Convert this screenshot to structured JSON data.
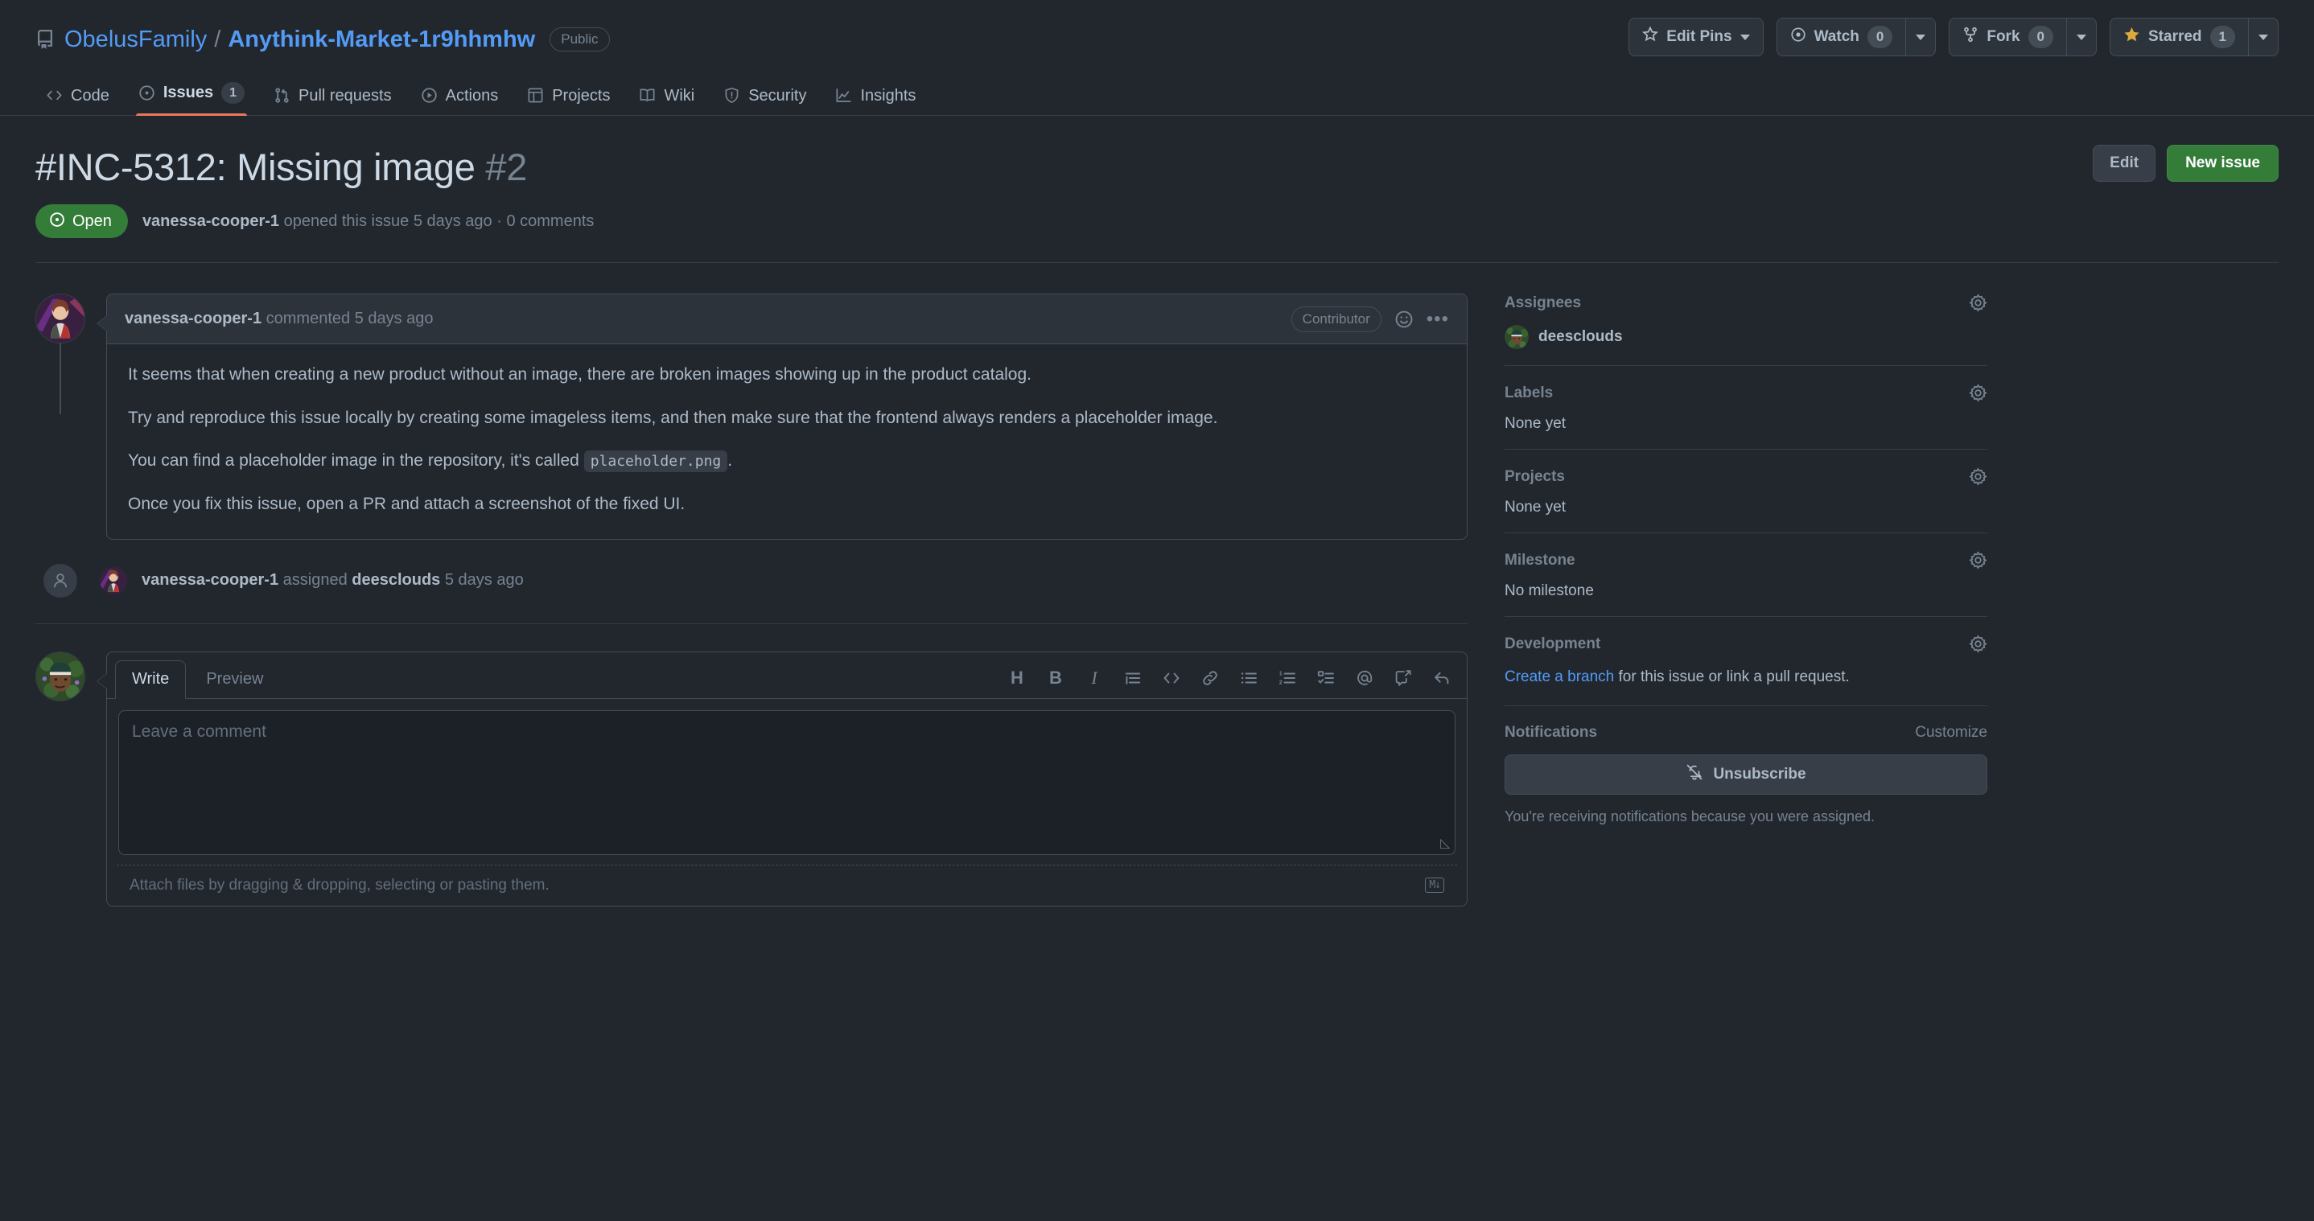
{
  "repo": {
    "owner": "ObelusFamily",
    "separator": "/",
    "name": "Anythink-Market-1r9hhmhw",
    "visibility": "Public",
    "repo_icon": "book-icon"
  },
  "repo_actions": {
    "edit_pins": {
      "label": "Edit Pins",
      "icon": "pin-icon"
    },
    "watch": {
      "label": "Watch",
      "count": "0",
      "icon": "eye-icon"
    },
    "fork": {
      "label": "Fork",
      "count": "0",
      "icon": "repo-forked-icon"
    },
    "starred": {
      "label": "Starred",
      "count": "1",
      "icon": "star-icon"
    }
  },
  "nav_tabs": [
    {
      "label": "Code",
      "icon": "code-icon",
      "count": null,
      "selected": false
    },
    {
      "label": "Issues",
      "icon": "issue-opened-icon",
      "count": "1",
      "selected": true
    },
    {
      "label": "Pull requests",
      "icon": "git-pull-request-icon",
      "count": null,
      "selected": false
    },
    {
      "label": "Actions",
      "icon": "play-icon",
      "count": null,
      "selected": false
    },
    {
      "label": "Projects",
      "icon": "table-icon",
      "count": null,
      "selected": false
    },
    {
      "label": "Wiki",
      "icon": "book-icon",
      "count": null,
      "selected": false
    },
    {
      "label": "Security",
      "icon": "shield-icon",
      "count": null,
      "selected": false
    },
    {
      "label": "Insights",
      "icon": "graph-icon",
      "count": null,
      "selected": false
    }
  ],
  "issue": {
    "title": "#INC-5312: Missing image",
    "number": "#2",
    "state": "Open",
    "state_color": "#347d39",
    "author": "vanessa-cooper-1",
    "opened_text": "opened this issue",
    "opened_time": "5 days ago",
    "comments_count": "0 comments",
    "separator_dot": "·",
    "edit_label": "Edit",
    "new_issue_label": "New issue"
  },
  "comment": {
    "author": "vanessa-cooper-1",
    "action": "commented",
    "time": "5 days ago",
    "role": "Contributor",
    "emoji_icon": "smiley-icon",
    "menu_icon": "kebab-horizontal-icon",
    "paragraphs": [
      "It seems that when creating a new product without an image, there are broken images showing up in the product catalog.",
      "Try and reproduce this issue locally by creating some imageless items, and then make sure that the frontend always renders a placeholder image."
    ],
    "p3_before": "You can find a placeholder image in the repository, it's called",
    "p3_code": "placeholder.png",
    "p3_after": ".",
    "p4": "Once you fix this issue, open a PR and attach a screenshot of the fixed UI."
  },
  "timeline_event": {
    "icon": "person-icon",
    "actor": "vanessa-cooper-1",
    "action": "assigned",
    "target": "deesclouds",
    "time": "5 days ago"
  },
  "composer": {
    "tabs": [
      {
        "label": "Write",
        "active": true
      },
      {
        "label": "Preview",
        "active": false
      }
    ],
    "toolbar": [
      {
        "name": "heading-icon",
        "glyph": "H"
      },
      {
        "name": "bold-icon",
        "glyph": "B"
      },
      {
        "name": "italic-icon",
        "glyph": "I"
      },
      {
        "name": "quote-icon",
        "glyph": ""
      },
      {
        "name": "code-icon",
        "glyph": ""
      },
      {
        "name": "link-icon",
        "glyph": ""
      },
      {
        "name": "unordered-list-icon",
        "glyph": ""
      },
      {
        "name": "ordered-list-icon",
        "glyph": ""
      },
      {
        "name": "task-list-icon",
        "glyph": ""
      },
      {
        "name": "mention-icon",
        "glyph": "@"
      },
      {
        "name": "reference-icon",
        "glyph": ""
      },
      {
        "name": "reply-icon",
        "glyph": ""
      }
    ],
    "placeholder": "Leave a comment",
    "value": "",
    "attach_text": "Attach files by dragging & dropping, selecting or pasting them.",
    "markdown_badge": "M↓"
  },
  "sidebar": {
    "assignees": {
      "title": "Assignees",
      "gear_icon": "gear-icon",
      "items": [
        {
          "name": "deesclouds"
        }
      ]
    },
    "labels": {
      "title": "Labels",
      "gear_icon": "gear-icon",
      "empty": "None yet"
    },
    "projects": {
      "title": "Projects",
      "gear_icon": "gear-icon",
      "empty": "None yet"
    },
    "milestone": {
      "title": "Milestone",
      "gear_icon": "gear-icon",
      "empty": "No milestone"
    },
    "development": {
      "title": "Development",
      "gear_icon": "gear-icon",
      "link": "Create a branch",
      "rest": " for this issue or link a pull request."
    },
    "notifications": {
      "title": "Notifications",
      "customize": "Customize",
      "button_label": "Unsubscribe",
      "bell_icon": "bell-slash-icon",
      "note": "You're receiving notifications because you were assigned."
    }
  },
  "colors": {
    "page_bg": "#22272e",
    "surface": "#2d333b",
    "border": "#444c56",
    "accent_blue": "#539bf5",
    "accent_green": "#347d39",
    "accent_orange": "#ec775c",
    "text": "#adbac7",
    "muted": "#768390",
    "star_yellow": "#daaa3f"
  }
}
